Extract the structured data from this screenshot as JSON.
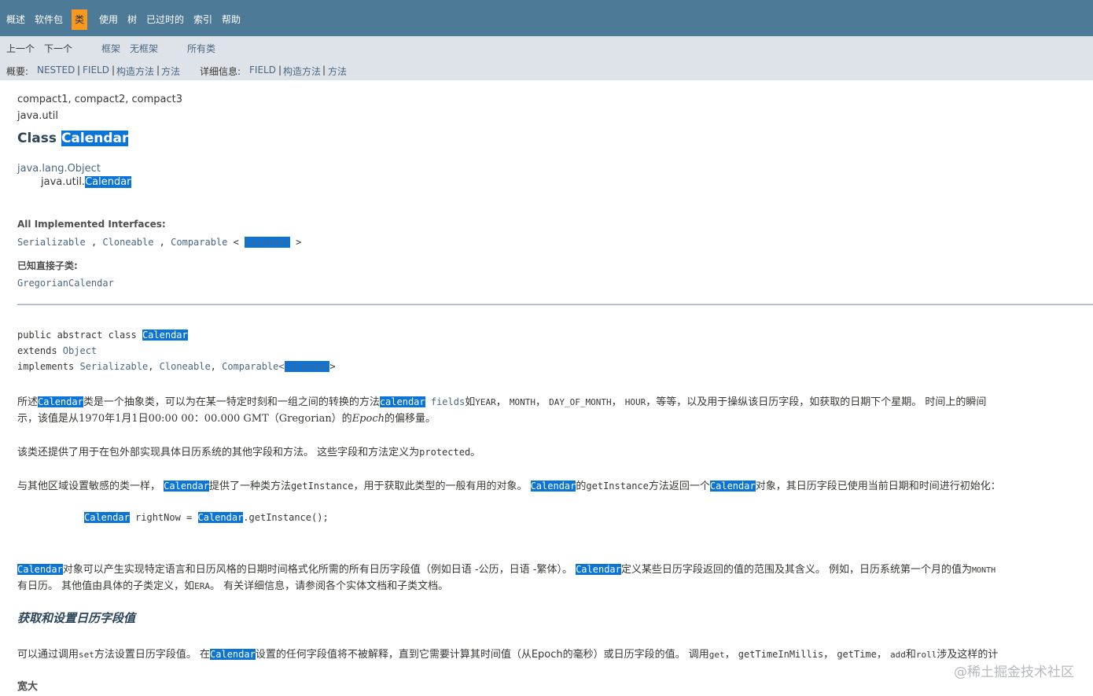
{
  "nav": {
    "items": [
      "概述",
      "软件包",
      "类",
      "使用",
      "树",
      "已过时的",
      "索引",
      "帮助"
    ],
    "active": "类"
  },
  "subnav": {
    "prev": "上一个",
    "next": "下一个",
    "frames": "框架",
    "no_frames": "无框架",
    "all_classes": "所有类",
    "summary_label": "概要:",
    "summary_links": [
      "NESTED",
      "FIELD",
      "构造方法",
      "方法"
    ],
    "detail_label": "详细信息:",
    "detail_links": [
      "FIELD",
      "构造方法",
      "方法"
    ],
    "separator": "|"
  },
  "header": {
    "profiles": "compact1, compact2, compact3",
    "package": "java.util",
    "title_prefix": "Class ",
    "title_name": "Calendar"
  },
  "inheritance": {
    "parent": "java.lang.Object",
    "child_prefix": "java.util.",
    "child_name": "Calendar"
  },
  "interfaces": {
    "label": "All Implemented Interfaces:",
    "items": [
      "Serializable",
      ",",
      "Cloneable",
      ",",
      "Comparable",
      "<",
      "Calendar",
      ">"
    ]
  },
  "subclasses": {
    "label": "已知直接子类:",
    "items": [
      "GregorianCalendar"
    ]
  },
  "signature": {
    "line1_prefix": "public abstract class ",
    "line1_name": "Calendar",
    "line2_prefix": "extends ",
    "line2_link": "Object",
    "line3_prefix": "implements ",
    "line3_links": [
      "Serializable",
      ", ",
      "Cloneable",
      ", ",
      "Comparable<"
    ],
    "line3_name": "Calendar",
    "line3_suffix": ">"
  },
  "desc": {
    "p1_a": "所述",
    "p1_b": "Calendar",
    "p1_c": "类是一个抽象类，可以为在某一特定时刻和一组之间的转换的方法",
    "p1_d": "calendar",
    "p1_e": " fields",
    "p1_f": "如",
    "p1_g": "YEAR",
    "p1_h": "， ",
    "p1_i": "MONTH",
    "p1_j": "， ",
    "p1_k": "DAY_OF_MONTH",
    "p1_l": "， ",
    "p1_m": "HOUR",
    "p1_n": "，等等，以及用于操纵该日历字段，如获取的日期下个星期。 时间上的瞬间",
    "p1_line2_a": "示，该值是从1970年1月1日00:00 00：00.000 GMT（Gregorian）的",
    "p1_line2_b": "Epoch",
    "p1_line2_c": "的偏移量。",
    "p2_a": "该类还提供了用于在包外部实现具体日历系统的其他字段和方法。 这些字段和方法定义为",
    "p2_b": "protected",
    "p2_c": "。",
    "p3_a": "与其他区域设置敏感的类一样， ",
    "p3_b": "Calendar",
    "p3_c": "提供了一种类方法",
    "p3_d": "getInstance",
    "p3_e": "，用于获取此类型的一般有用的对象。 ",
    "p3_f": "Calendar",
    "p3_g": "的",
    "p3_h": "getInstance",
    "p3_i": "方法返回一个",
    "p3_j": "Calendar",
    "p3_k": "对象，其日历字段已使用当前日期和时间进行初始化：",
    "code_a": "Calendar",
    "code_b": " rightNow = ",
    "code_c": "Calendar",
    "code_d": ".getInstance();",
    "p4_a": "Calendar",
    "p4_b": "对象可以产生实现特定语言和日历风格的日期时间格式化所需的所有日历字段值（例如日语 -公历，日语 -繁体）。 ",
    "p4_c": "Calendar",
    "p4_d": "定义某些日历字段返回的值的范围及其含义。 例如，日历系统第一个月的值为",
    "p4_e": "MONTH",
    "p4_line2_a": "有日历。 其他值由具体的子类定义，如",
    "p4_line2_b": "ERA",
    "p4_line2_c": "。 有关详细信息，请参阅各个实体文档和子类文档。",
    "h3": "获取和设置日历字段值",
    "p5_a": "可以通过调用",
    "p5_b": "set",
    "p5_c": "方法设置日历字段值。 在",
    "p5_d": "Calendar",
    "p5_e": "设置的任何字段值将不被解释，直到它需要计算其时间值（从Epoch的毫秒）或日历字段的值。 调用",
    "p5_f": "get",
    "p5_g": "， ",
    "p5_h": "getTimeInMillis",
    "p5_i": "， ",
    "p5_j": "getTime",
    "p5_k": "， ",
    "p5_l": "add",
    "p5_m": "和",
    "p5_n": "roll",
    "p5_o": "涉及这样的计",
    "h4": "宽大"
  },
  "watermark": "@稀土掘金技术社区"
}
